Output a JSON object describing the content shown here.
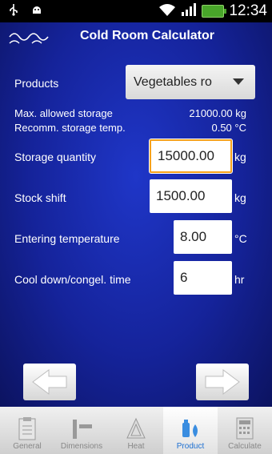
{
  "status_bar": {
    "time": "12:34"
  },
  "header": {
    "title": "Cold Room Calculator"
  },
  "products": {
    "label": "Products",
    "selected": "Vegetables ro"
  },
  "info": {
    "max_storage_label": "Max. allowed storage",
    "max_storage_value": "21000.00 kg",
    "storage_temp_label": "Recomm. storage temp.",
    "storage_temp_value": "0.50 °C"
  },
  "fields": {
    "storage_quantity": {
      "label": "Storage quantity",
      "value": "15000.00",
      "unit": "kg"
    },
    "stock_shift": {
      "label": "Stock shift",
      "value": "1500.00",
      "unit": "kg"
    },
    "entering_temperature": {
      "label": "Entering temperature",
      "value": "8.00",
      "unit": "°C"
    },
    "cool_down_time": {
      "label": "Cool down/congel. time",
      "value": "6",
      "unit": "hr"
    }
  },
  "tabs": [
    {
      "label": "General",
      "icon": "clipboard-icon"
    },
    {
      "label": "Dimensions",
      "icon": "dimensions-icon"
    },
    {
      "label": "Heat",
      "icon": "heat-icon"
    },
    {
      "label": "Product",
      "icon": "product-icon"
    },
    {
      "label": "Calculate",
      "icon": "calculator-icon"
    }
  ],
  "active_tab": "Product",
  "colors": {
    "accent_tab": "#1c6fd1",
    "background": "#15239a",
    "focus_border": "#f7a21b"
  }
}
